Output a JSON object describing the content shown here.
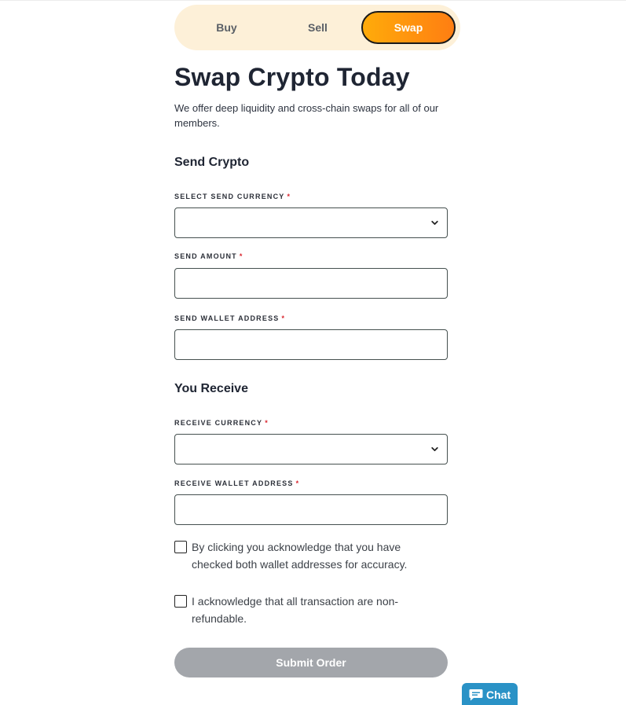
{
  "tabs": [
    {
      "label": "Buy",
      "active": false
    },
    {
      "label": "Sell",
      "active": false
    },
    {
      "label": "Swap",
      "active": true
    }
  ],
  "page": {
    "title": "Swap Crypto Today",
    "subtitle": "We offer deep liquidity and cross-chain swaps for all of our members."
  },
  "send_section": {
    "title": "Send Crypto",
    "currency_label": "SELECT SEND CURRENCY",
    "currency_value": "",
    "amount_label": "SEND AMOUNT",
    "amount_value": "",
    "wallet_label": "SEND WALLET ADDRESS",
    "wallet_value": ""
  },
  "receive_section": {
    "title": "You Receive",
    "currency_label": "RECEIVE CURRENCY",
    "currency_value": "",
    "wallet_label": "RECEIVE WALLET ADDRESS",
    "wallet_value": ""
  },
  "required_marker": "*",
  "checkboxes": [
    {
      "text": "By clicking you acknowledge that you have checked both wallet addresses for accuracy.",
      "checked": false
    },
    {
      "text": "I acknowledge that all transaction are non-refundable.",
      "checked": false
    }
  ],
  "submit": {
    "label": "Submit Order",
    "enabled": false
  },
  "chat": {
    "label": "Chat"
  },
  "colors": {
    "accent_start": "#ffab0a",
    "accent_end": "#ff7e12",
    "tab_bg": "#fdf0d8",
    "required": "#d9262f",
    "submit_disabled": "#a3a6ab",
    "chat_bg": "#2a92c6"
  },
  "icons": {
    "select_arrow": "chevron-down-icon",
    "chat": "chat-bubble-icon"
  }
}
